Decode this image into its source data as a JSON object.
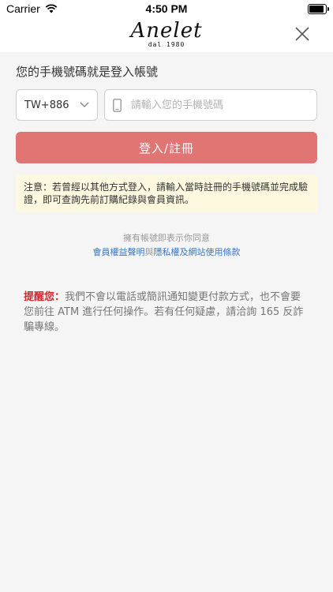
{
  "status": {
    "carrier": "Carrier",
    "time": "4:50 PM"
  },
  "header": {
    "logo": "Anelet",
    "logo_sub": "dal 1980"
  },
  "form": {
    "label": "您的手機號碼就是登入帳號",
    "country_code": "TW+886",
    "phone_placeholder": "請輸入您的手機號碼",
    "login_button": "登入/註冊"
  },
  "notice": "注意：若曾經以其他方式登入，請輸入當時註冊的手機號碼並完成驗證，即可查詢先前訂購紀錄與會員資訊。",
  "agreement": {
    "prefix": "擁有帳號即表示你同意",
    "link_terms": "會員權益聲明",
    "conj": "與",
    "link_privacy": "隱私權及網站使用條款"
  },
  "reminder": {
    "prefix": "提醒您：",
    "text": "我們不會以電話或簡訊通知變更付款方式，也不會要您前往 ATM 進行任何操作。若有任何疑慮，請洽詢 165 反詐騙專線。"
  },
  "colors": {
    "button": "#e07574",
    "link": "#3b78c2",
    "warning": "#d0292c",
    "notice_bg": "#fdf8e0"
  },
  "icons": [
    "wifi-icon",
    "battery-icon",
    "close-icon",
    "chevron-down-icon",
    "phone-icon"
  ]
}
